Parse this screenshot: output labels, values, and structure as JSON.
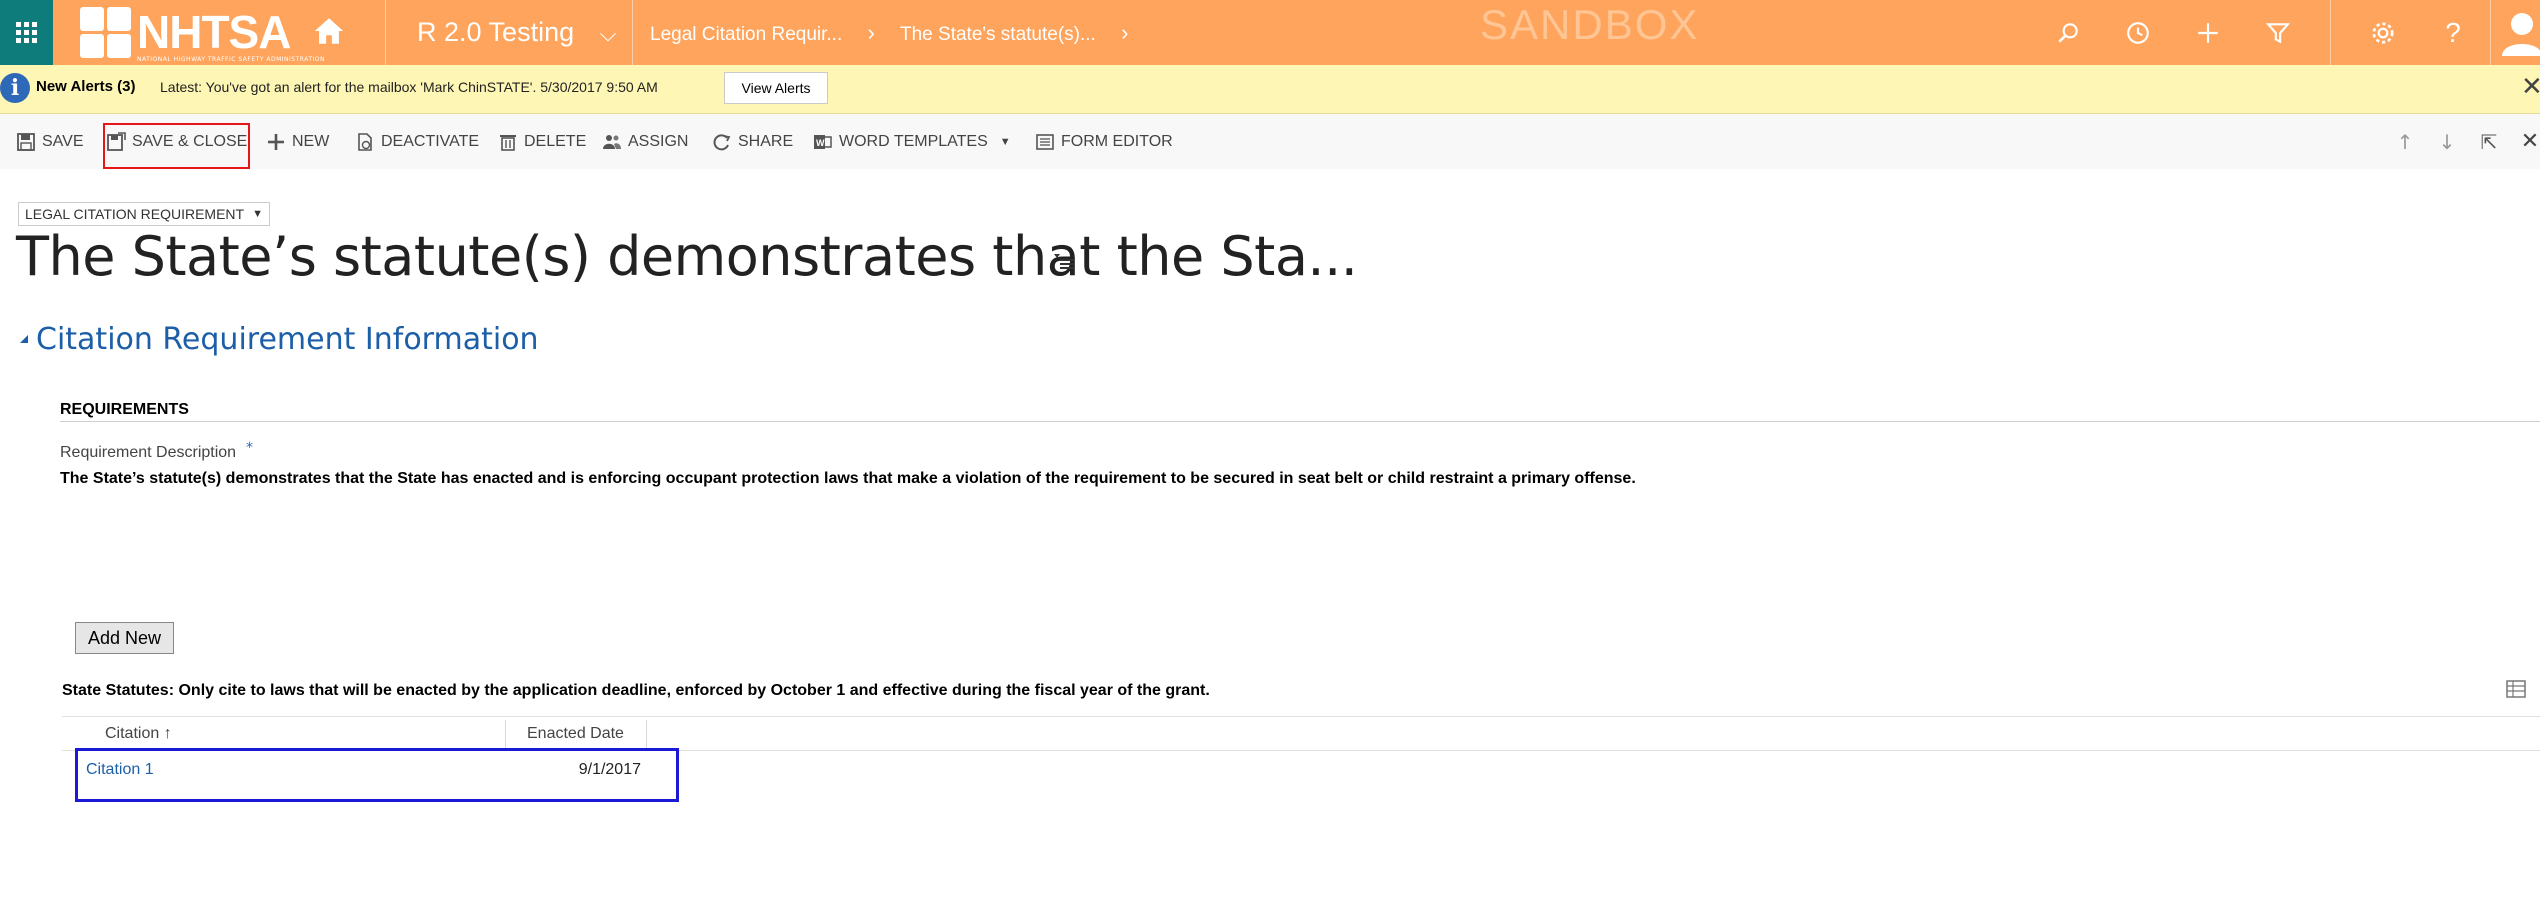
{
  "nav": {
    "logo_text": "NHTSA",
    "logo_subtext": "NATIONAL HIGHWAY TRAFFIC SAFETY ADMINISTRATION",
    "app_name": "R 2.0 Testing",
    "breadcrumbs": [
      "Legal Citation Requir...",
      "The State's statute(s)..."
    ],
    "environment_label": "SANDBOX",
    "icons": [
      "search-icon",
      "history-icon",
      "plus-icon",
      "filter-icon",
      "gear-icon",
      "help-icon",
      "user-avatar-icon"
    ],
    "colors": {
      "bar": "#FFA45C",
      "waffle": "#0E7C7B"
    }
  },
  "alerts": {
    "title": "New Alerts (3)",
    "message": "Latest: You've got an alert for the mailbox 'Mark ChinSTATE'. 5/30/2017 9:50 AM",
    "button": "View Alerts"
  },
  "commands": {
    "save": "SAVE",
    "save_close": "SAVE & CLOSE",
    "new": "NEW",
    "deactivate": "DEACTIVATE",
    "delete": "DELETE",
    "assign": "ASSIGN",
    "share": "SHARE",
    "word_templates": "WORD TEMPLATES",
    "form_editor": "FORM EDITOR"
  },
  "form": {
    "entity_selector": "LEGAL CITATION REQUIREMENT",
    "record_title": "The State’s statute(s) demonstrates that the Sta...",
    "section_title": "Citation Requirement Information",
    "requirements_heading": "REQUIREMENTS",
    "requirement_label": "Requirement Description",
    "required_marker": "*",
    "requirement_value": "The State’s statute(s) demonstrates that the State has enacted and is enforcing occupant protection laws that make a violation of the requirement to be secured in seat belt or child restraint a primary offense."
  },
  "subgrid": {
    "add_button": "Add New",
    "title": "State Statutes: Only cite to laws that will be enacted by the application deadline, enforced by October 1 and effective during the fiscal year of the grant.",
    "columns": [
      "Citation ↑",
      "Enacted Date"
    ],
    "rows": [
      {
        "citation": "Citation 1",
        "enacted_date": "9/1/2017"
      }
    ]
  }
}
